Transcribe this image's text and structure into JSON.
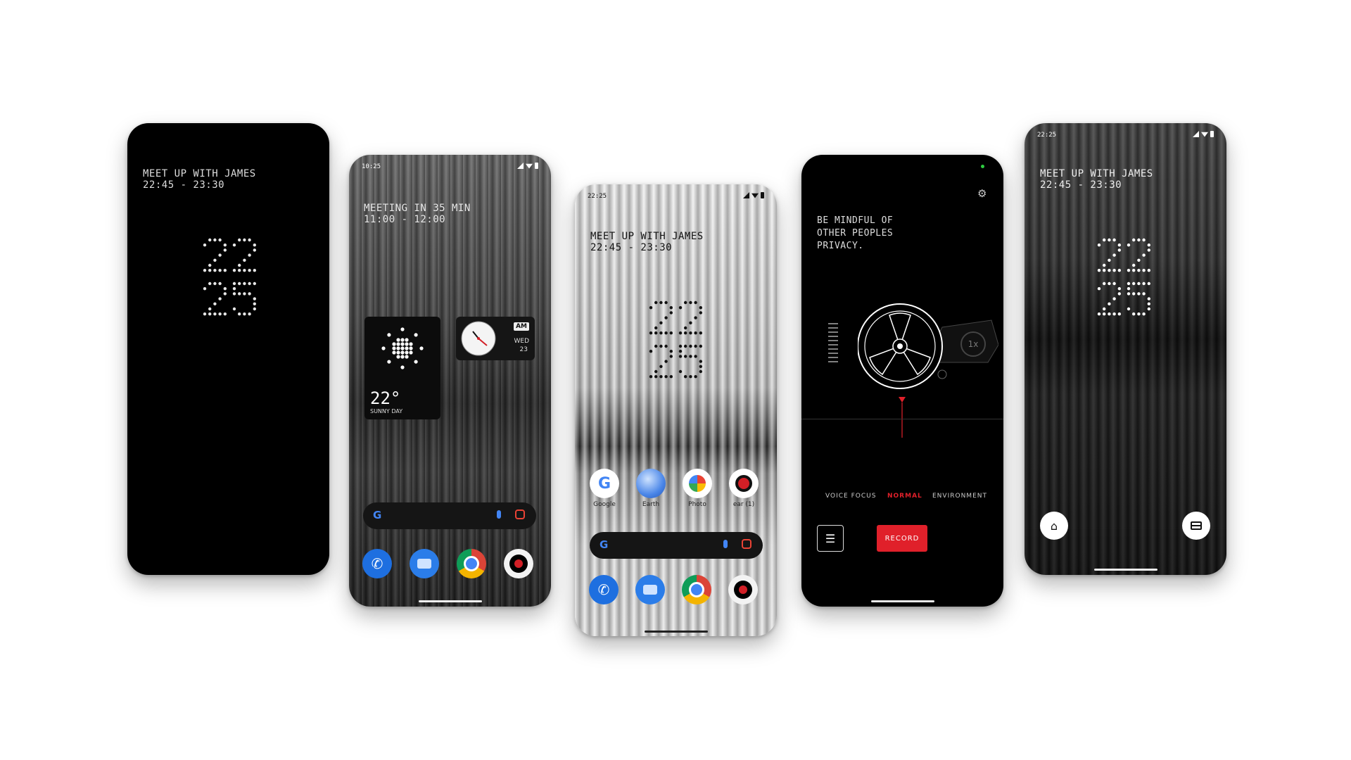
{
  "phones": {
    "p1": {
      "event_title": "MEET UP WITH JAMES",
      "event_time": "22:45 - 23:30",
      "clock_hours": "22",
      "clock_minutes": "25"
    },
    "p2": {
      "status_time": "10:25",
      "event_title": "MEETING IN 35 MIN",
      "event_time": "11:00 - 12:00",
      "weather_temp": "22°",
      "weather_condition": "SUNNY DAY",
      "clock_ampm": "AM",
      "clock_day": "WED",
      "clock_date": "23",
      "search_g": "G"
    },
    "p3": {
      "status_time": "22:25",
      "event_title": "MEET UP WITH JAMES",
      "event_time": "22:45 - 23:30",
      "clock_hours": "22",
      "clock_minutes": "25",
      "apps": [
        "Google",
        "Earth",
        "Photo",
        "ear (1)"
      ],
      "search_g": "G"
    },
    "p4": {
      "privacy_line1": "BE MINDFUL OF",
      "privacy_line2": "OTHER PEOPLES",
      "privacy_line3": "PRIVACY.",
      "zoom_label": "1x",
      "modes": [
        "VOICE FOCUS",
        "NORMAL",
        "ENVIRONMENT"
      ],
      "active_mode": "NORMAL",
      "record_label": "RECORD",
      "accent_color": "#e0202a"
    },
    "p5": {
      "status_time": "22:25",
      "event_title": "MEET UP WITH JAMES",
      "event_time": "22:45 - 23:30",
      "clock_hours": "22",
      "clock_minutes": "25"
    }
  }
}
